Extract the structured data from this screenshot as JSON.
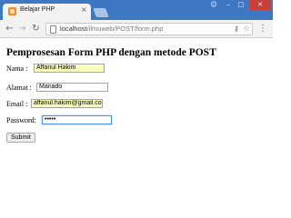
{
  "browser": {
    "tab_title": "Belajar PHP",
    "tab_close": "×",
    "url_host": "localhost",
    "url_path": "/ilmuweb/POST/form.php",
    "window_controls": {
      "user": "☺",
      "minimize": "–",
      "maximize": "□",
      "close": "✕"
    }
  },
  "page": {
    "heading": "Pemprosesan Form PHP dengan metode POST",
    "fields": {
      "nama": {
        "label": "Nama :",
        "value": "Affanul Hakim"
      },
      "alamat": {
        "label": "Alamat :",
        "value": "Manado"
      },
      "email": {
        "label": "Email :",
        "value": "affanul.hakim@gmail.com"
      },
      "password": {
        "label": "Password:",
        "value": "•••••"
      }
    },
    "submit_label": "Submit"
  },
  "colors": {
    "titlebar": "#3f78c2",
    "autofill": "#faffbd",
    "focus_border": "#4d90fe"
  },
  "icons": [
    "favicon-icon",
    "back-arrow-icon",
    "forward-arrow-icon",
    "reload-icon",
    "page-icon",
    "key-icon",
    "star-icon",
    "menu-icon"
  ]
}
